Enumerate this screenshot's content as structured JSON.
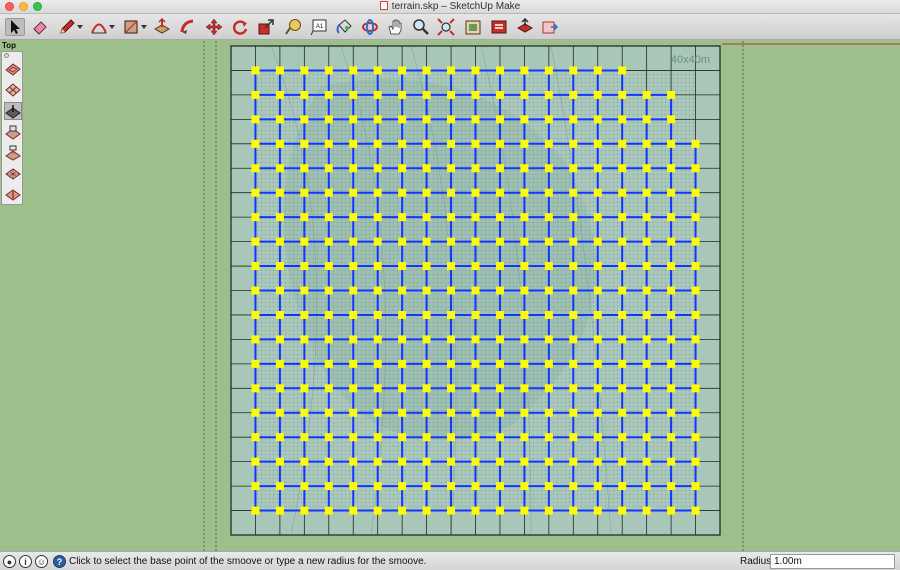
{
  "window": {
    "title": "terrain.skp – SketchUp Make"
  },
  "toolbar": {
    "tools": [
      {
        "name": "select-tool",
        "icon": "arrow-cursor-icon"
      },
      {
        "name": "eraser-tool",
        "icon": "eraser-icon"
      },
      {
        "name": "pencil-tool",
        "icon": "pencil-icon"
      },
      {
        "name": "arc-tool",
        "icon": "arc-icon"
      },
      {
        "name": "shapes-tool",
        "icon": "rectangle-icon"
      },
      {
        "name": "push-pull-tool",
        "icon": "push-pull-icon"
      },
      {
        "name": "follow-me-tool",
        "icon": "follow-me-icon"
      },
      {
        "name": "move-tool",
        "icon": "move-icon"
      },
      {
        "name": "rotate-tool",
        "icon": "rotate-icon"
      },
      {
        "name": "scale-tool",
        "icon": "scale-icon"
      },
      {
        "name": "tape-measure-tool",
        "icon": "tape-measure-icon"
      },
      {
        "name": "text-tool",
        "icon": "text-icon"
      },
      {
        "name": "paint-bucket-tool",
        "icon": "paint-bucket-icon"
      },
      {
        "name": "orbit-tool",
        "icon": "orbit-icon"
      },
      {
        "name": "pan-tool",
        "icon": "pan-hand-icon"
      },
      {
        "name": "zoom-tool",
        "icon": "zoom-icon"
      },
      {
        "name": "zoom-extents-tool",
        "icon": "zoom-extents-icon"
      },
      {
        "name": "3d-warehouse-tool",
        "icon": "warehouse-icon"
      },
      {
        "name": "extension-warehouse-tool",
        "icon": "extension-icon"
      },
      {
        "name": "share-model-tool",
        "icon": "share-model-icon"
      },
      {
        "name": "send-to-layout-tool",
        "icon": "layout-icon"
      }
    ]
  },
  "viewport": {
    "view_name": "Top",
    "terrain_label": "40x40m",
    "grid": {
      "columns": 20,
      "rows": 20,
      "highlight_cols": 18,
      "highlight_rows": 18
    }
  },
  "sandbox_palette": {
    "tools": [
      {
        "name": "from-contours-tool",
        "icon": "from-contours-icon"
      },
      {
        "name": "from-scratch-tool",
        "icon": "from-scratch-icon"
      },
      {
        "name": "smoove-tool",
        "icon": "smoove-icon"
      },
      {
        "name": "stamp-tool",
        "icon": "stamp-icon"
      },
      {
        "name": "drape-tool",
        "icon": "drape-icon"
      },
      {
        "name": "add-detail-tool",
        "icon": "add-detail-icon"
      },
      {
        "name": "flip-edge-tool",
        "icon": "flip-edge-icon"
      }
    ]
  },
  "statusbar": {
    "message": "Click to select the base point of the smoove or type a new radius for the smoove.",
    "vcb_label": "Radius",
    "vcb_value": "1.00m"
  },
  "colors": {
    "background": "#9cbf8c",
    "terrain_fill": "#a9c7b9",
    "grid_line": "#1e2a22",
    "selected_edge": "#1436ff",
    "selected_vertex": "#ffff00",
    "red_axis": "#c0342a"
  }
}
